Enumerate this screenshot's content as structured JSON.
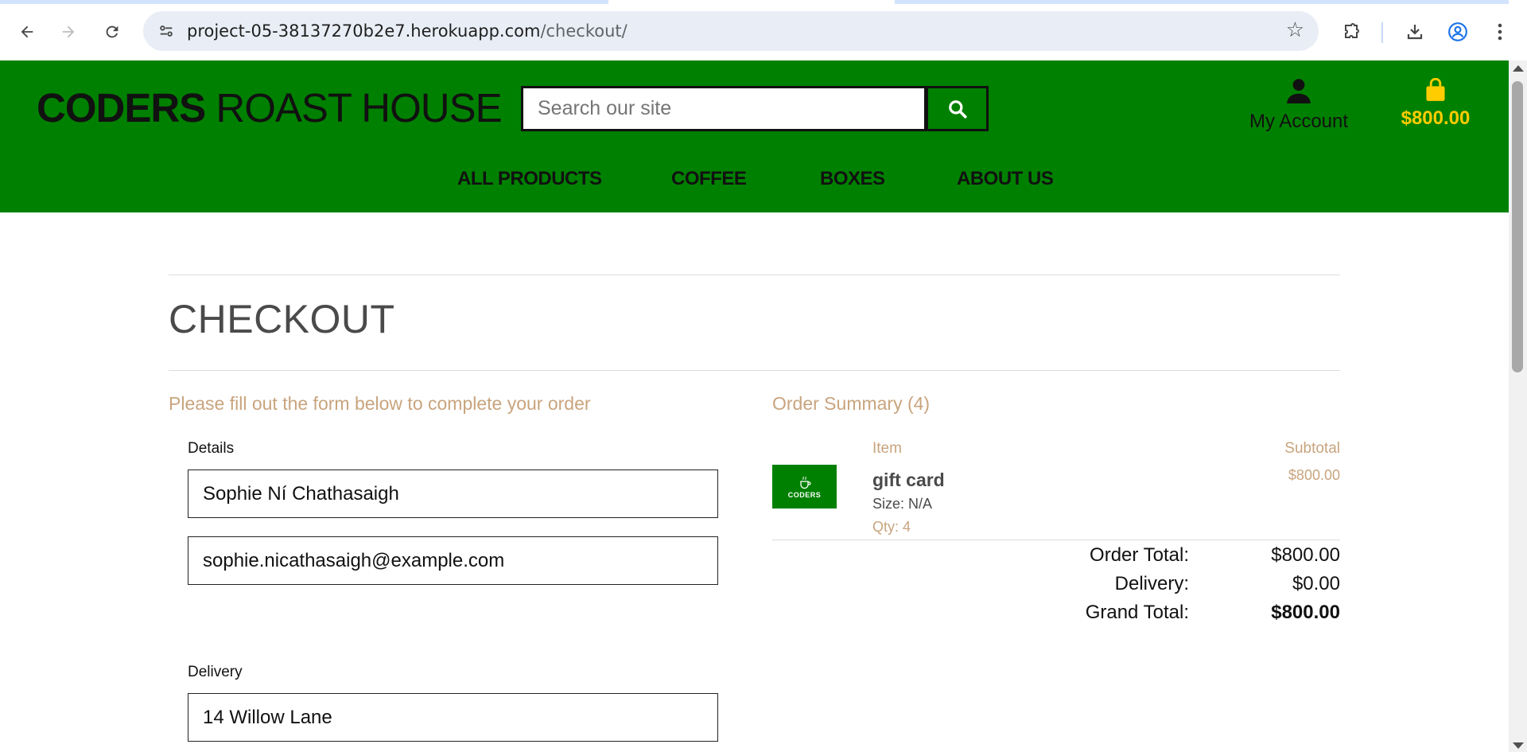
{
  "browser": {
    "url_host": "project-05-38137270b2e7.herokuapp.com",
    "url_path": "/checkout/",
    "icons": {
      "back": "arrow-left-icon",
      "forward": "arrow-right-icon",
      "reload": "reload-icon",
      "site_info": "tune-icon",
      "bookmark": "star-icon",
      "extensions": "puzzle-icon",
      "downloads": "download-icon",
      "profile": "profile-icon",
      "menu": "kebab-menu-icon"
    }
  },
  "header": {
    "logo_bold": "CODERS",
    "logo_rest": " ROAST HOUSE",
    "search_placeholder": "Search our site",
    "account_label": "My Account",
    "bag_total": "$800.00",
    "nav": [
      "ALL PRODUCTS",
      "COFFEE",
      "BOXES",
      "ABOUT US"
    ],
    "colors": {
      "header_bg": "#008000",
      "bag_accent": "#ffcc00"
    }
  },
  "checkout": {
    "title": "CHECKOUT",
    "form_intro": "Please fill out the form below to complete your order",
    "details_legend": "Details",
    "full_name": "Sophie Ní Chathasaigh",
    "email": "sophie.nicathasaigh@example.com",
    "delivery_legend": "Delivery",
    "street_address": "14 Willow Lane"
  },
  "summary": {
    "title": "Order Summary (4)",
    "col_item": "Item",
    "col_subtotal": "Subtotal",
    "thumb_text": "CODERS",
    "items": [
      {
        "name": "gift card",
        "size": "Size: N/A",
        "qty": "Qty: 4",
        "subtotal": "$800.00"
      }
    ],
    "order_total_label": "Order Total:",
    "order_total": "$800.00",
    "delivery_label": "Delivery:",
    "delivery": "$0.00",
    "grand_total_label": "Grand Total:",
    "grand_total": "$800.00",
    "colors": {
      "accent_tan": "#c8a47e"
    }
  }
}
